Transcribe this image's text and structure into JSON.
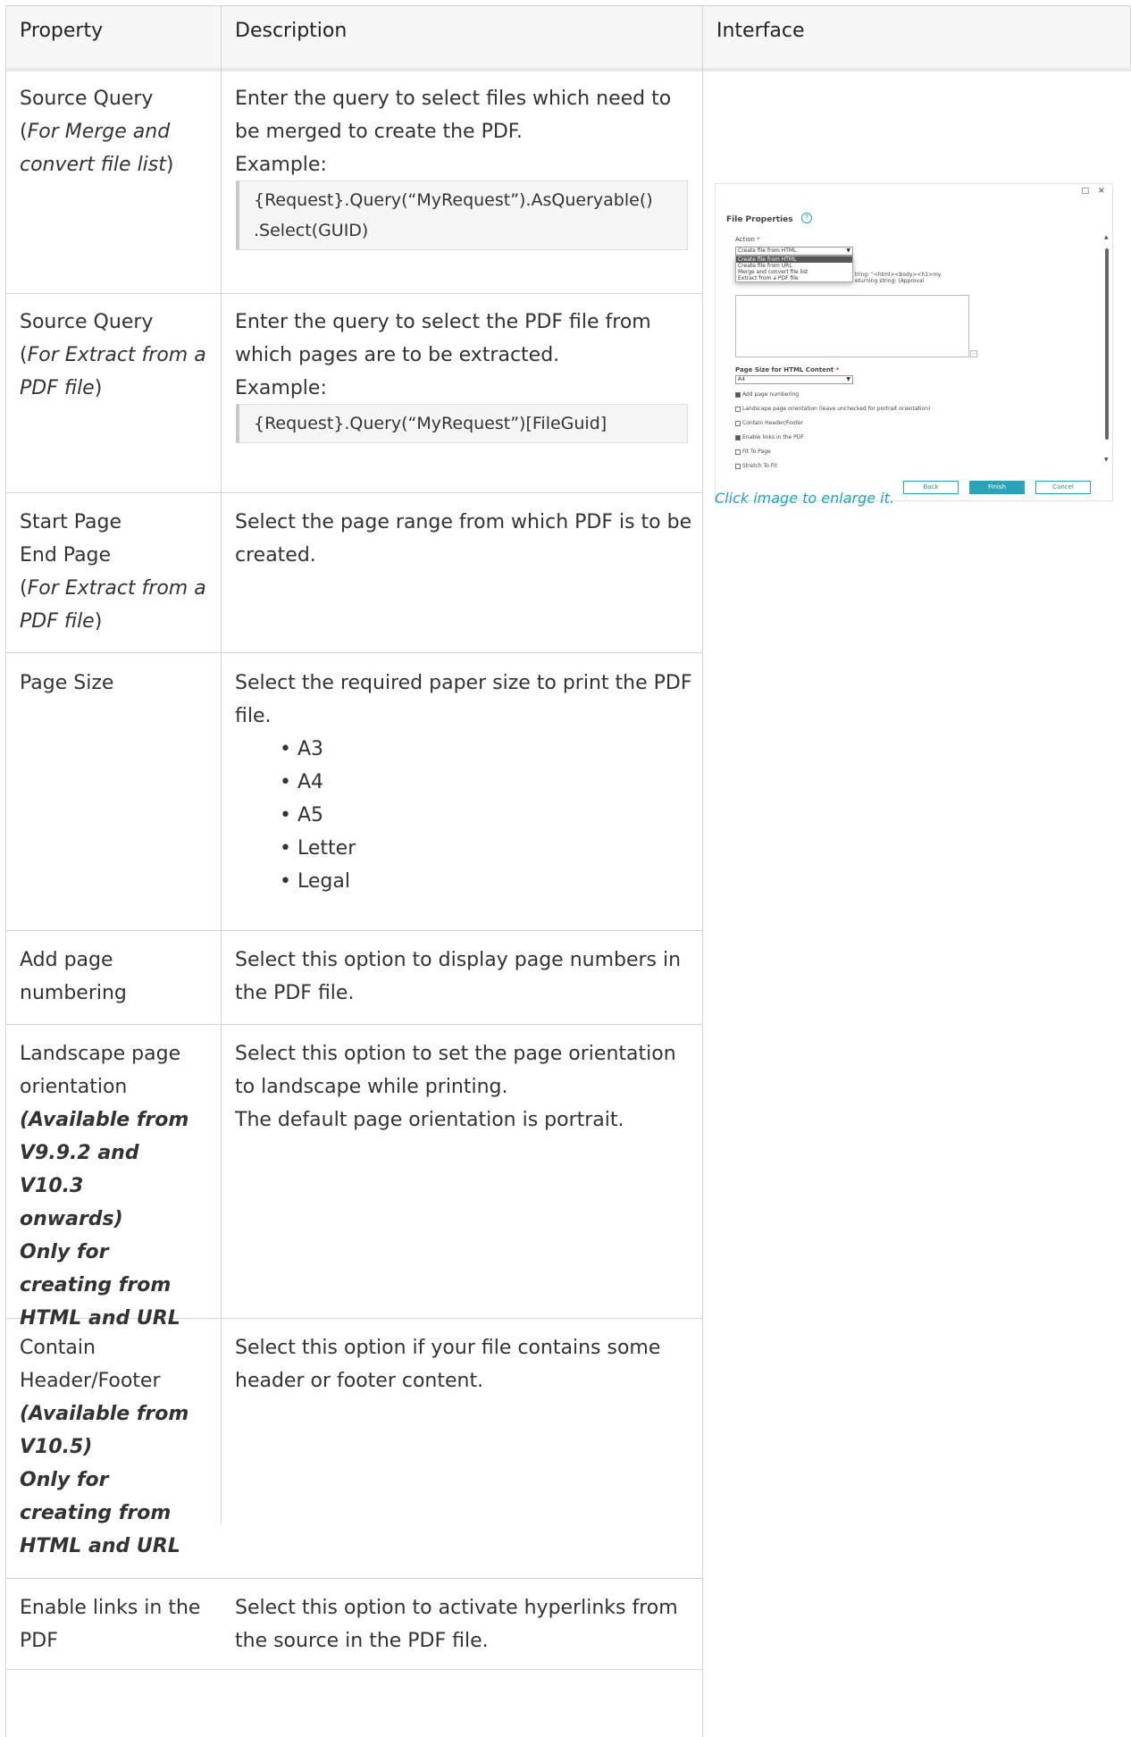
{
  "header": {
    "property": "Property",
    "description": "Description",
    "interface": "Interface"
  },
  "rows": [
    {
      "property_lines": [
        "Source Query",
        "(",
        "For Merge and convert file list",
        ")"
      ],
      "description": "Enter the query to select files which need to be merged to create the PDF.",
      "example_label": "Example:",
      "code_line1": "{Request}.Query(“MyRequest”).AsQueryable()",
      "code_line2": ".Select(GUID)"
    },
    {
      "property_lines": [
        "Source Query",
        "(",
        "For Extract from a PDF file",
        ")"
      ],
      "description": "Enter the query to select the PDF file from which pages are to be extracted.",
      "example_label": "Example:",
      "code_line1": "{Request}.Query(“MyRequest”)[FileGuid]"
    },
    {
      "property_lines": [
        "Start Page",
        "End Page",
        "(",
        "For Extract from a PDF file",
        ")"
      ],
      "description": "Select the page range from which PDF is to be created."
    },
    {
      "property": "Page Size",
      "description": "Select the required paper size to print the PDF file.",
      "sizes": [
        "A3",
        "A4",
        "A5",
        "Letter",
        "Legal"
      ]
    },
    {
      "property": "Add page numbering",
      "description": "Select this option to display page numbers in the PDF file."
    },
    {
      "property": "Landscape page orientation",
      "note1": "(Available from V9.9.2  and V10.3 onwards)",
      "note2": "Only for creating from HTML and URL",
      "description": "Select this option to set the page orientation to landscape while printing.",
      "description2": "The default page orientation is portrait."
    },
    {
      "property": "Contain Header/Footer",
      "note1": "(Available from V10.5)",
      "note2": "Only for creating from HTML and URL",
      "description": "Select this option if your file contains some header or footer content."
    },
    {
      "property": "Enable links in the PDF",
      "description": "Select this option to activate hyperlinks from the source in the PDF file."
    }
  ],
  "dialog": {
    "title": "File Properties",
    "help_icon": "question-circle-icon",
    "action_label": "Action",
    "required_mark": "*",
    "action_value": "Create file from HTML",
    "action_options": [
      "Create file from HTML",
      "Create file from URL",
      "Merge and convert file list",
      "Extract from a PDF file"
    ],
    "behind_text1": "tring: \"<html><body><h1>my",
    "behind_text2": "eturning string: (Approval",
    "page_size_label": "Page Size for HTML Content",
    "page_size_value": "A4",
    "options": [
      {
        "label": "Add page numbering",
        "checked": true
      },
      {
        "label": "Landscape page orientation (leave unchecked for portrait orientation)",
        "checked": false
      },
      {
        "label": "Contain Header/Footer",
        "checked": false
      },
      {
        "label": "Enable links in the PDF",
        "checked": true
      },
      {
        "label": "Fit To Page",
        "checked": false
      },
      {
        "label": "Stretch To Fit",
        "checked": false
      }
    ],
    "back_button": "Back",
    "finish_button": "Finish",
    "cancel_button": "Cancel",
    "accent_color": "#2aa4b9"
  },
  "caption": "Click image to enlarge it."
}
